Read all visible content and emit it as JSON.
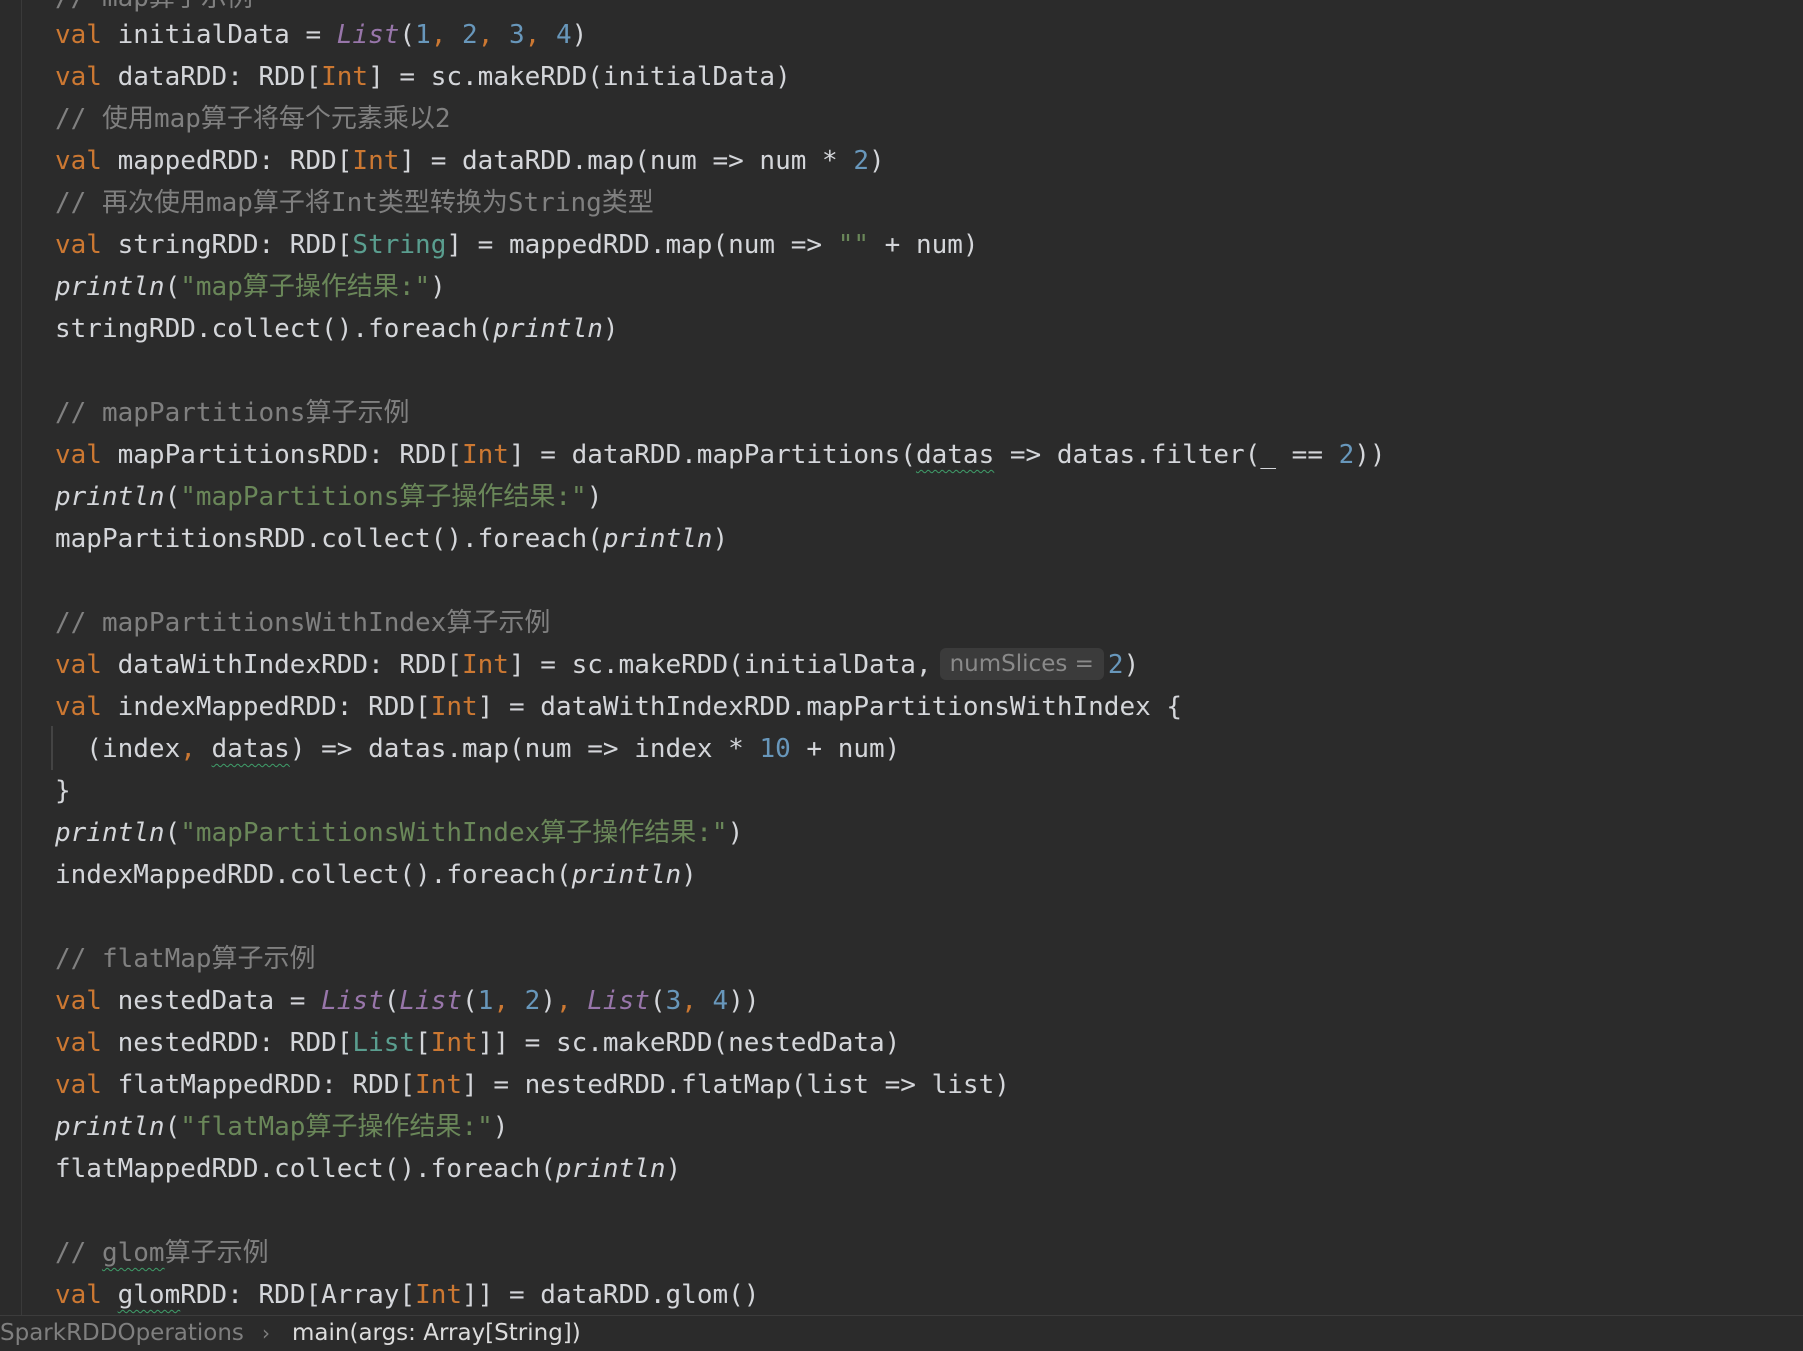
{
  "editor": {
    "lines": {
      "top_comment": "// map算子示例",
      "l01": {
        "kw": "val",
        "name": " initialData = ",
        "fn": "List",
        "open": "(",
        "n1": "1",
        "c1": ", ",
        "n2": "2",
        "c2": ", ",
        "n3": "3",
        "c3": ", ",
        "n4": "4",
        "close": ")"
      },
      "l02": {
        "kw": "val",
        "a": " dataRDD: RDD[",
        "ty": "Int",
        "b": "] = sc.makeRDD(initialData)"
      },
      "l03": {
        "cmt": "// 使用map算子将每个元素乘以2"
      },
      "l04": {
        "kw": "val",
        "a": " mappedRDD: RDD[",
        "ty": "Int",
        "b": "] = dataRDD.map(num => num * ",
        "num": "2",
        "c": ")"
      },
      "l05": {
        "cmt": "// 再次使用map算子将Int类型转换为String类型"
      },
      "l06": {
        "kw": "val",
        "a": " stringRDD: RDD[",
        "ty": "String",
        "b": "] = mappedRDD.map(num => ",
        "str": "\"\"",
        "c": " + num)"
      },
      "l07": {
        "fn": "println",
        "open": "(",
        "str": "\"map算子操作结果:\"",
        "close": ")"
      },
      "l08": {
        "a": "stringRDD.collect().foreach(",
        "fn": "println",
        "b": ")"
      },
      "l09": {
        "cmt": "// mapPartitions算子示例"
      },
      "l10": {
        "kw": "val",
        "a": " mapPartitionsRDD: RDD[",
        "ty": "Int",
        "b": "] = dataRDD.mapPartitions(",
        "sq": "datas",
        "c": " => datas.filter(_ == ",
        "num": "2",
        "d": "))"
      },
      "l11": {
        "fn": "println",
        "open": "(",
        "str": "\"mapPartitions算子操作结果:\"",
        "close": ")"
      },
      "l12": {
        "a": "mapPartitionsRDD.collect().foreach(",
        "fn": "println",
        "b": ")"
      },
      "l13": {
        "cmt": "// mapPartitionsWithIndex算子示例"
      },
      "l14": {
        "kw": "val",
        "a": " dataWithIndexRDD: RDD[",
        "ty": "Int",
        "b": "] = sc.makeRDD(initialData,",
        "hint": "numSlices =",
        "num": "2",
        "c": ")"
      },
      "l15": {
        "kw": "val",
        "a": " indexMappedRDD: RDD[",
        "ty": "Int",
        "b": "] = dataWithIndexRDD.mapPartitionsWithIndex {"
      },
      "l16": {
        "a": "  (index",
        "comma": ",",
        "b": " ",
        "sq": "datas",
        "c": ") => datas.map(num => index * ",
        "num": "10",
        "d": " + num)"
      },
      "l17": {
        "a": "}"
      },
      "l18": {
        "fn": "println",
        "open": "(",
        "str": "\"mapPartitionsWithIndex算子操作结果:\"",
        "close": ")"
      },
      "l19": {
        "a": "indexMappedRDD.collect().foreach(",
        "fn": "println",
        "b": ")"
      },
      "l20": {
        "cmt": "// flatMap算子示例"
      },
      "l21": {
        "kw": "val",
        "a": " nestedData = ",
        "fn1": "List",
        "o1": "(",
        "fn2": "List",
        "o2": "(",
        "n1": "1",
        "c1": ", ",
        "n2": "2",
        "p1": ")",
        "c2": ", ",
        "fn3": "List",
        "o3": "(",
        "n3": "3",
        "c3": ", ",
        "n4": "4",
        "p2": "))"
      },
      "l22": {
        "kw": "val",
        "a": " nestedRDD: RDD[",
        "ty1": "List",
        "b": "[",
        "ty2": "Int",
        "c": "]] = sc.makeRDD(nestedData)"
      },
      "l23": {
        "kw": "val",
        "a": " flatMappedRDD: RDD[",
        "ty": "Int",
        "b": "] = nestedRDD.flatMap(list => list)"
      },
      "l24": {
        "fn": "println",
        "open": "(",
        "str": "\"flatMap算子操作结果:\"",
        "close": ")"
      },
      "l25": {
        "a": "flatMappedRDD.collect().foreach(",
        "fn": "println",
        "b": ")"
      },
      "l26": {
        "c1": "// ",
        "sq": "glom",
        "c2": "算子示例"
      },
      "l27": {
        "kw": "val",
        "a": " ",
        "sq": "glom",
        "b": "RDD: RDD[Array[",
        "ty": "Int",
        "c": "]] = dataRDD.glom()"
      }
    }
  },
  "statusbar": {
    "breadcrumb_object": "SparkRDDOperations",
    "breadcrumb_separator": "›",
    "breadcrumb_method": "main(args: Array[String])"
  },
  "colors": {
    "background": "#2b2b2b",
    "keyword": "#cc7832",
    "number": "#6897bb",
    "string": "#6a8759",
    "comment": "#808080",
    "function_italic": "#9876aa"
  }
}
